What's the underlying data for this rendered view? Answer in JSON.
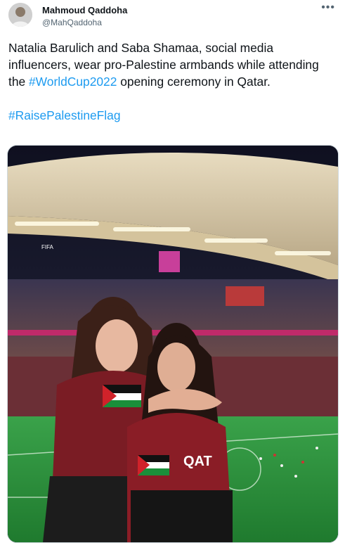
{
  "tweet": {
    "author_name": "Mahmoud Qaddoha",
    "author_handle": "@MahQaddoha",
    "more_icon": "more-options-icon",
    "text_part1": "Natalia Barulich and Saba Shamaa, social media influencers, wear pro-Palestine armbands while attending the ",
    "hashtag1": "#WorldCup2022",
    "text_part2": " opening ceremony in Qatar.",
    "hashtag2": "#RaisePalestineFlag",
    "media_alt": "Two women hugging in a stadium at the World Cup 2022 opening ceremony"
  },
  "stadium_signage": {
    "left_sign": "FIFA",
    "jersey_text": "QAT"
  },
  "colors": {
    "hashtag": "#1d9bf0",
    "text": "#0f1419",
    "secondary": "#536471"
  }
}
